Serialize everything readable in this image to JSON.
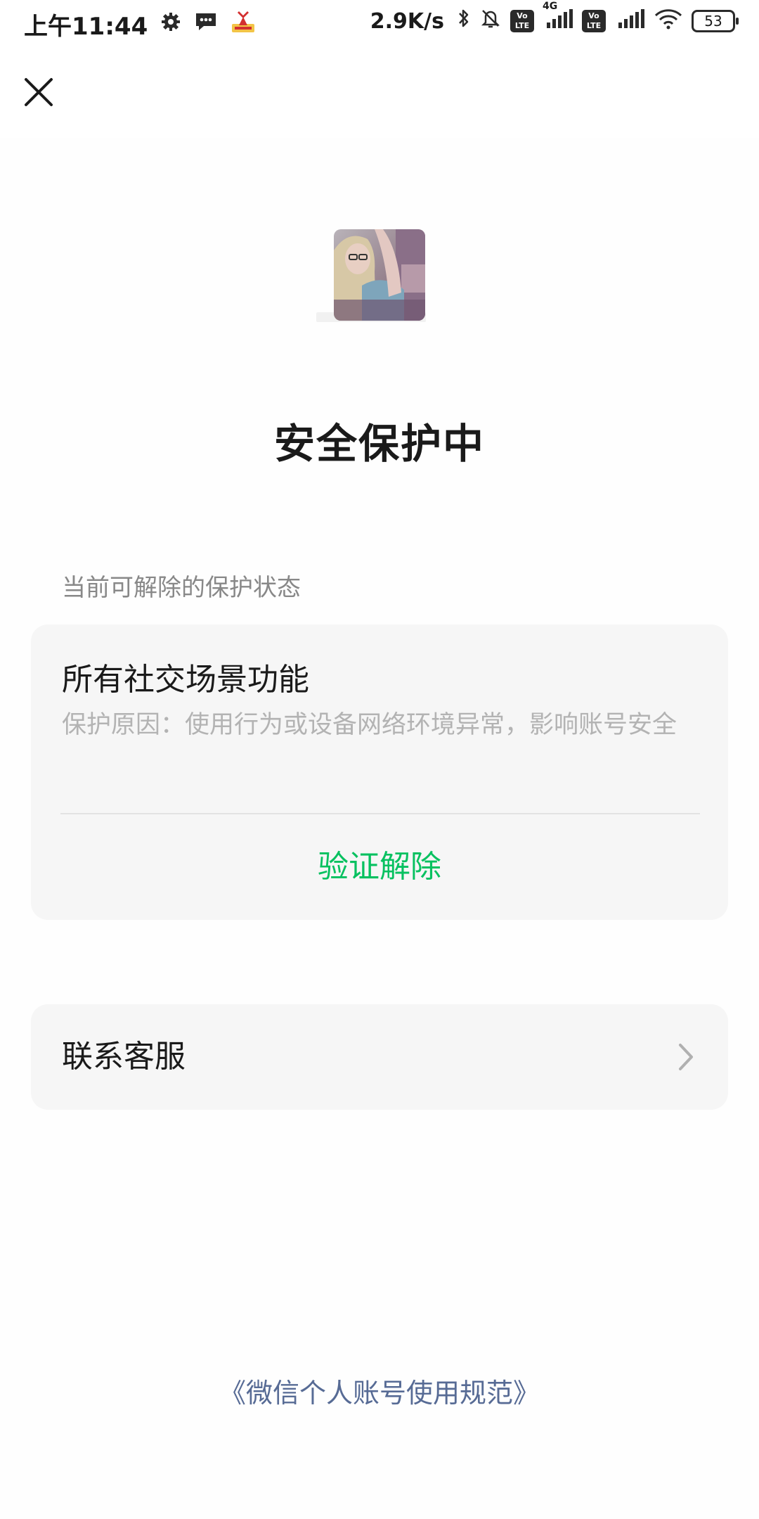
{
  "status_bar": {
    "time": "上午11:44",
    "speed": "2.9K/s",
    "network_type": "4G",
    "lte_label_top": "Vo",
    "lte_label_bottom": "LTE",
    "battery": "53",
    "icons": [
      "gear-icon",
      "message-icon",
      "app-notification-icon",
      "bluetooth-icon",
      "bell-muted-icon",
      "signal-icon",
      "wifi-icon",
      "battery-icon"
    ]
  },
  "header": {
    "close_icon": "close-icon"
  },
  "main": {
    "title": "安全保护中",
    "section_label": "当前可解除的保护状态",
    "protect_card": {
      "title": "所有社交场景功能",
      "reason": "保护原因：使用行为或设备网络环境异常，影响账号安全",
      "action_label": "验证解除"
    },
    "contact_card": {
      "label": "联系客服",
      "icon": "chevron-right-icon"
    },
    "footer_link": "《微信个人账号使用规范》"
  },
  "colors": {
    "accent_green": "#07c160",
    "link_blue": "#576b95",
    "card_background": "#f6f6f6",
    "muted_text": "#b3b3b3",
    "label_gray": "#888888"
  }
}
